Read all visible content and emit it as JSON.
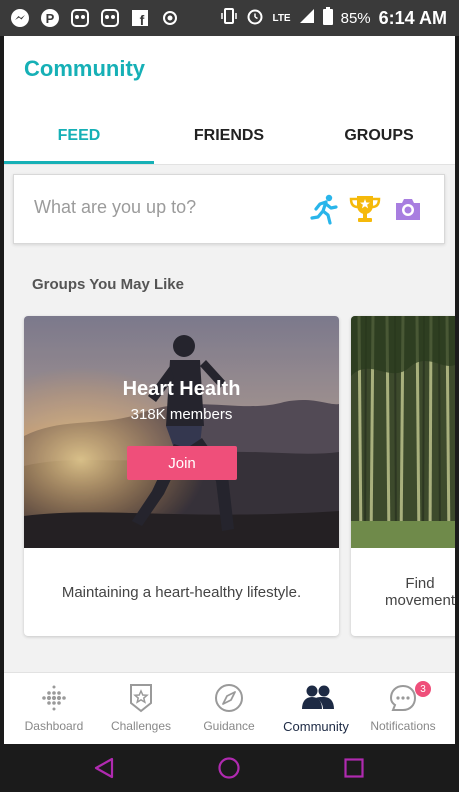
{
  "status_bar": {
    "battery": "85%",
    "time": "6:14 AM",
    "network": "LTE",
    "left_icons": [
      "messenger-icon",
      "pinterest-icon",
      "fitbit-owl-icon",
      "fitbit-owl-icon",
      "facebook-icon",
      "record-icon"
    ]
  },
  "header": {
    "title": "Community"
  },
  "tabs": [
    {
      "label": "FEED",
      "active": true
    },
    {
      "label": "FRIENDS",
      "active": false
    },
    {
      "label": "GROUPS",
      "active": false
    }
  ],
  "composer": {
    "placeholder": "What are you up to?",
    "icons": [
      "run-icon",
      "trophy-icon",
      "camera-icon"
    ]
  },
  "groups_section": {
    "title": "Groups You May Like",
    "cards": [
      {
        "name": "Heart Health",
        "members": "318K members",
        "join_label": "Join",
        "description": "Maintaining a heart-healthy lifestyle."
      },
      {
        "description": "Find movement"
      }
    ]
  },
  "bottom_nav": {
    "items": [
      {
        "label": "Dashboard",
        "icon": "dashboard-icon"
      },
      {
        "label": "Challenges",
        "icon": "challenges-icon"
      },
      {
        "label": "Guidance",
        "icon": "compass-icon"
      },
      {
        "label": "Community",
        "icon": "community-icon",
        "active": true
      },
      {
        "label": "Notifications",
        "icon": "notifications-icon",
        "badge": "3"
      }
    ]
  },
  "colors": {
    "accent": "#16b0b6",
    "join": "#ef4f7a",
    "nav_active": "#1d2a44"
  }
}
